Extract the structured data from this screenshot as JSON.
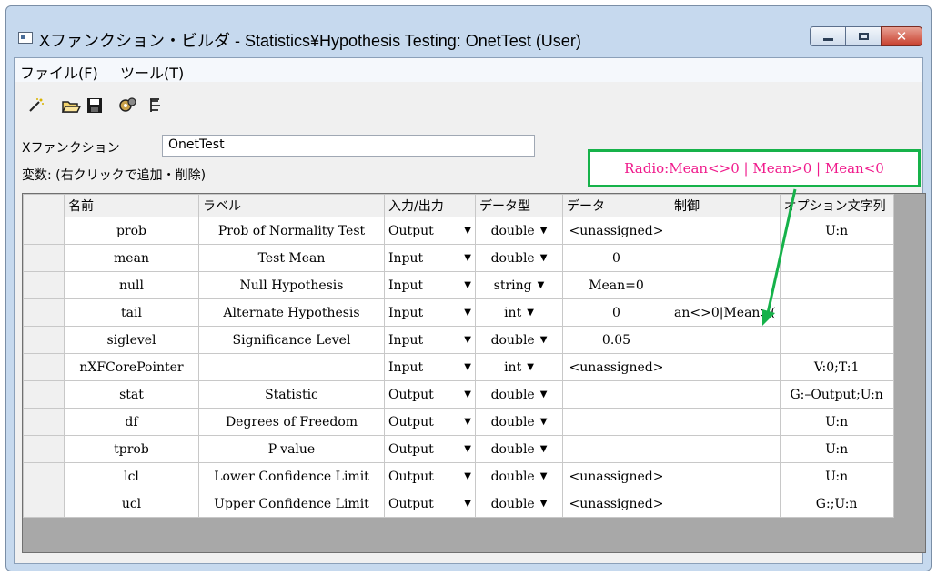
{
  "window": {
    "title": "Xファンクション・ビルダ - Statistics¥Hypothesis Testing: OnetTest (User)"
  },
  "menu": [
    "ファイル(F)",
    "ツール(T)"
  ],
  "toolbar_icons": [
    "new-icon",
    "open-folder-icon",
    "save-icon",
    "tools-icon",
    "tree-icon"
  ],
  "form": {
    "xfunction_label": "Xファンクション",
    "xfunction_value": "OnetTest",
    "vars_label": "変数: (右クリックで追加・削除)"
  },
  "callout": {
    "text": "Radio:Mean<>0 | Mean>0 | Mean<0",
    "border_color": "#16b24a",
    "text_color": "#f01a8c"
  },
  "grid": {
    "columns": [
      "名前",
      "ラベル",
      "入力/出力",
      "データ型",
      "データ",
      "制御",
      "オプション文字列"
    ],
    "rows": [
      {
        "name": "prob",
        "label": "Prob of Normality Test",
        "io": "Output",
        "type": "double",
        "data": "<unassigned>",
        "control": "",
        "option": "U:n"
      },
      {
        "name": "mean",
        "label": "Test Mean",
        "io": "Input",
        "type": "double",
        "data": "0",
        "control": "",
        "option": ""
      },
      {
        "name": "null",
        "label": "Null Hypothesis",
        "io": "Input",
        "type": "string",
        "data": "Mean=0",
        "control": "",
        "option": ""
      },
      {
        "name": "tail",
        "label": "Alternate Hypothesis",
        "io": "Input",
        "type": "int",
        "data": "0",
        "control": "an<>0|Mean>(",
        "option": ""
      },
      {
        "name": "siglevel",
        "label": "Significance Level",
        "io": "Input",
        "type": "double",
        "data": "0.05",
        "control": "",
        "option": ""
      },
      {
        "name": "nXFCorePointer",
        "label": "",
        "io": "Input",
        "type": "int",
        "data": "<unassigned>",
        "control": "",
        "option": "V:0;T:1"
      },
      {
        "name": "stat",
        "label": "Statistic",
        "io": "Output",
        "type": "double",
        "data": "",
        "control": "",
        "option": "G:–Output;U:n"
      },
      {
        "name": "df",
        "label": "Degrees of Freedom",
        "io": "Output",
        "type": "double",
        "data": "",
        "control": "",
        "option": "U:n"
      },
      {
        "name": "tprob",
        "label": "P-value",
        "io": "Output",
        "type": "double",
        "data": "",
        "control": "",
        "option": "U:n"
      },
      {
        "name": "lcl",
        "label": "Lower Confidence Limit",
        "io": "Output",
        "type": "double",
        "data": "<unassigned>",
        "control": "",
        "option": "U:n"
      },
      {
        "name": "ucl",
        "label": "Upper Confidence Limit",
        "io": "Output",
        "type": "double",
        "data": "<unassigned>",
        "control": "",
        "option": "G:;U:n"
      }
    ]
  }
}
